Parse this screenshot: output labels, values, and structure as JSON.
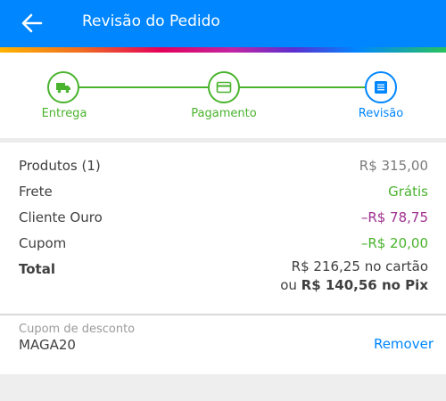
{
  "header": {
    "title": "Revisão do Pedido",
    "back_icon": "arrow-left-icon",
    "background_color": "#0086ff"
  },
  "steps": [
    {
      "label": "Entrega",
      "icon": "truck-icon",
      "state": "done",
      "color": "#4ab32d"
    },
    {
      "label": "Pagamento",
      "icon": "card-icon",
      "state": "done",
      "color": "#4ab32d"
    },
    {
      "label": "Revisão",
      "icon": "document-icon",
      "state": "current",
      "color": "#0086ff"
    }
  ],
  "summary": {
    "products": {
      "label": "Produtos (1)",
      "value": "R$ 315,00"
    },
    "shipping": {
      "label": "Frete",
      "value": "Grátis"
    },
    "gold_client": {
      "label": "Cliente Ouro",
      "value": "–R$ 78,75"
    },
    "coupon": {
      "label": "Cupom",
      "value": "–R$ 20,00"
    },
    "total": {
      "label": "Total",
      "card_amount": "R$ 216,25",
      "card_suffix": "no cartão",
      "pix_prefix": "ou",
      "pix_amount": "R$ 140,56 no Pix"
    }
  },
  "coupon_field": {
    "label": "Cupom de desconto",
    "code": "MAGA20",
    "remove_label": "Remover"
  },
  "colors": {
    "primary": "#0086ff",
    "success": "#4ab32d",
    "discount_purple": "#9e2f8f"
  }
}
